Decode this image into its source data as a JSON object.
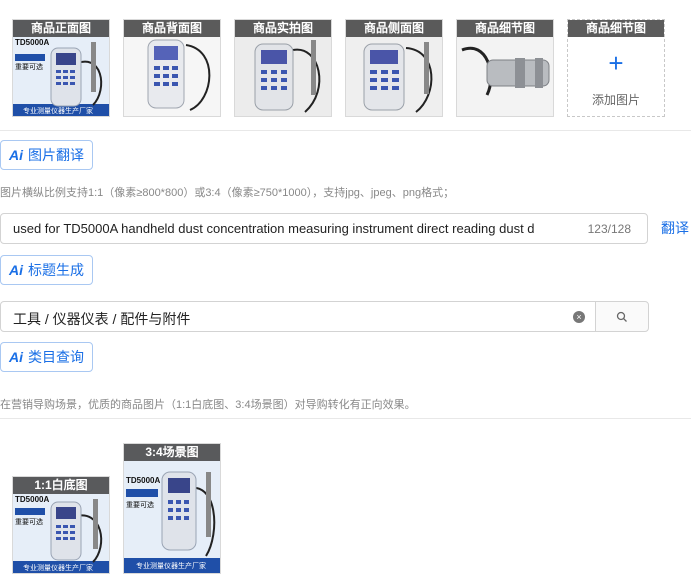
{
  "images": {
    "items": [
      {
        "caption": "商品正面图",
        "texts": [
          "TD5000A",
          "重要可选",
          "专业测量仪器生产厂家"
        ]
      },
      {
        "caption": "商品背面图",
        "texts": []
      },
      {
        "caption": "商品实拍图",
        "texts": []
      },
      {
        "caption": "商品侧面图",
        "texts": []
      },
      {
        "caption": "商品细节图",
        "texts": []
      }
    ],
    "add_slot": {
      "caption": "商品细节图",
      "plus": "+",
      "label": "添加图片"
    },
    "translate_button": "图片翻译",
    "ai_badge": "Ai",
    "hint": "图片横纵比例支持1:1（像素≥800*800）或3:4（像素≥750*1000），支持jpg、jpeg、png格式；"
  },
  "title_field": {
    "value": "used for TD5000A handheld dust concentration measuring instrument direct reading dust d",
    "counter": "123/128",
    "translate_link": "翻译",
    "generate_button": "标题生成"
  },
  "category_field": {
    "value": "工具 / 仪器仪表 / 配件与附件",
    "clear_icon": "×",
    "query_button": "类目查询"
  },
  "scene_images": {
    "hint": "在营销导购场景，优质的商品图片（1:1白底图、3:4场景图）对导购转化有正向效果。",
    "white_bg": {
      "caption": "1:1白底图",
      "texts": [
        "TD5000A",
        "重要可选",
        "专业测量仪器生产厂家"
      ]
    },
    "scene": {
      "caption": "3:4场景图",
      "texts": [
        "TD5000A",
        "重要可选",
        "专业测量仪器生产厂家"
      ]
    }
  },
  "colors": {
    "accent": "#1a6fe6",
    "caption_bg": "#464646",
    "device_blue": "#1f4fa8"
  }
}
